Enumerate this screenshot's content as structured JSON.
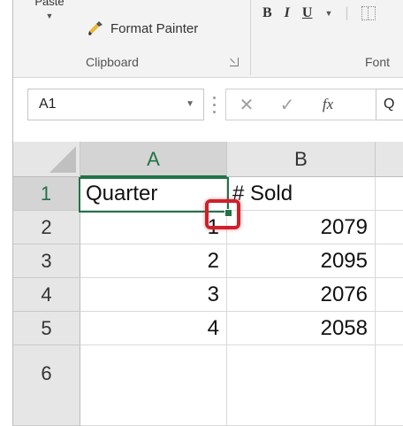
{
  "ribbon": {
    "paste_label": "Paste",
    "format_painter_label": "Format Painter",
    "bold": "B",
    "italic": "I",
    "underline": "U",
    "clipboard_group": "Clipboard",
    "font_group": "Font"
  },
  "formula_bar": {
    "name_box": "A1",
    "fx": "fx",
    "formula_value": "Q"
  },
  "grid": {
    "columns": [
      "A",
      "B"
    ],
    "rows": [
      {
        "num": "1",
        "a": "Quarter",
        "b": "# Sold"
      },
      {
        "num": "2",
        "a": "1",
        "b": "2079"
      },
      {
        "num": "3",
        "a": "2",
        "b": "2095"
      },
      {
        "num": "4",
        "a": "3",
        "b": "2076"
      },
      {
        "num": "5",
        "a": "4",
        "b": "2058"
      }
    ],
    "partial_row_num": "6"
  },
  "colors": {
    "accent": "#217346",
    "highlight": "#d0202a"
  }
}
